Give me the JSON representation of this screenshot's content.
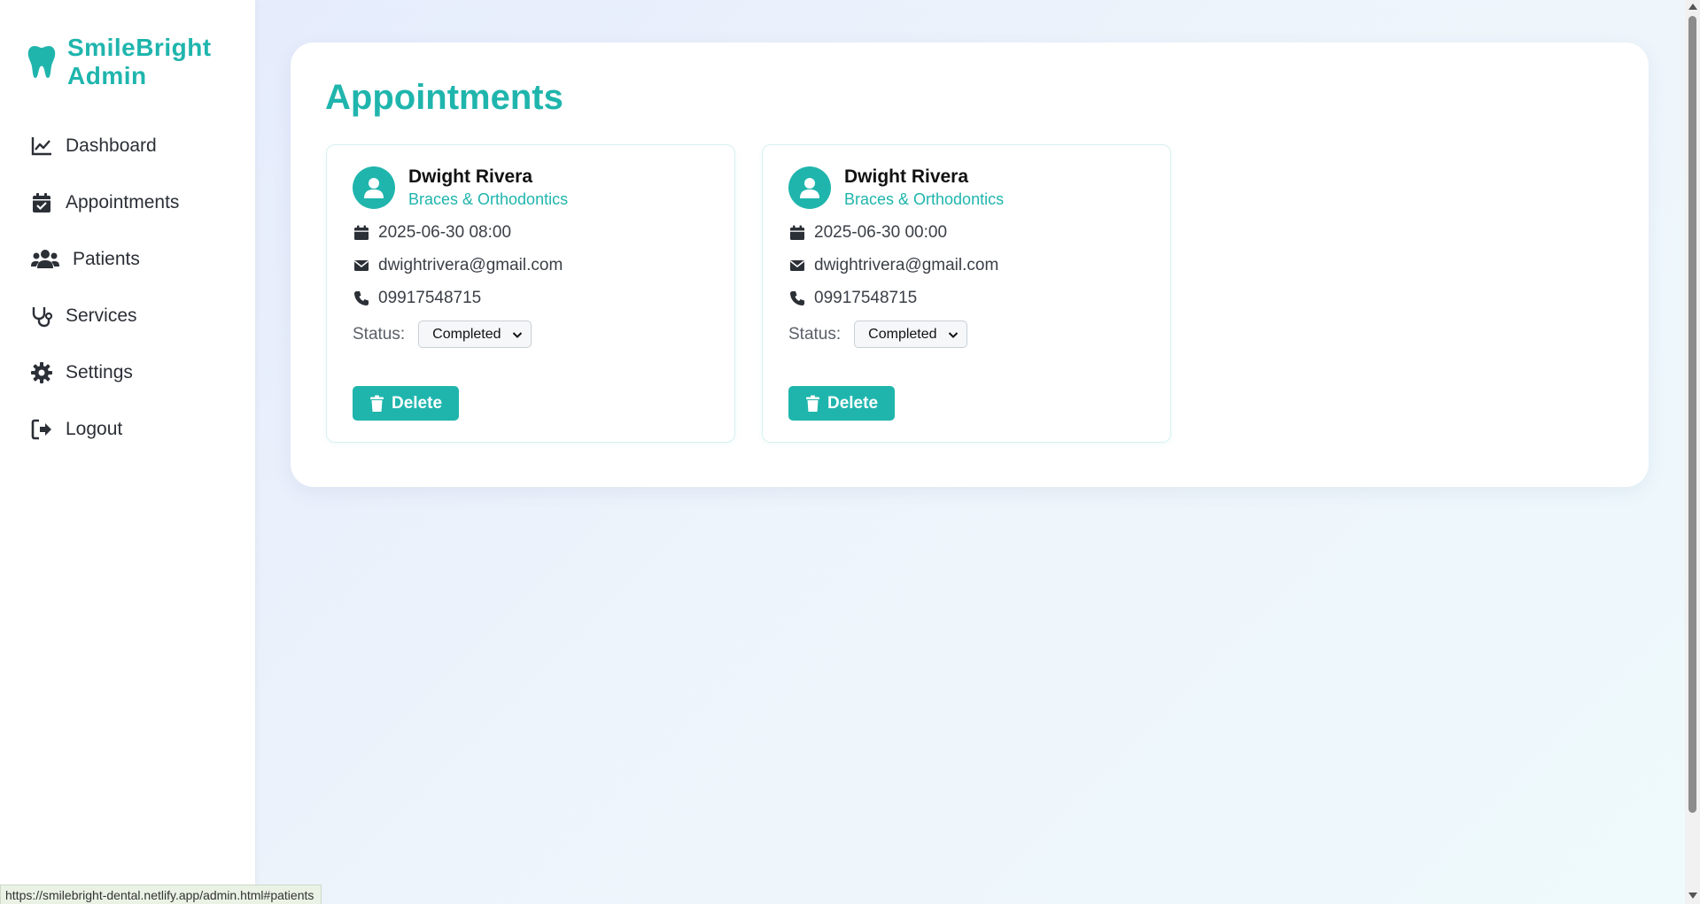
{
  "brand": {
    "name": "SmileBright Admin",
    "icon": "tooth-icon",
    "accent": "#1fb5ad"
  },
  "sidebar": {
    "items": [
      {
        "label": "Dashboard",
        "icon": "chart-line-icon"
      },
      {
        "label": "Appointments",
        "icon": "calendar-check-icon"
      },
      {
        "label": "Patients",
        "icon": "users-icon"
      },
      {
        "label": "Services",
        "icon": "stethoscope-icon"
      },
      {
        "label": "Settings",
        "icon": "gear-icon"
      },
      {
        "label": "Logout",
        "icon": "logout-icon"
      }
    ]
  },
  "main": {
    "title": "Appointments",
    "appointments": [
      {
        "name": "Dwight Rivera",
        "service": "Braces & Orthodontics",
        "datetime": "2025-06-30 08:00",
        "email": "dwightrivera@gmail.com",
        "phone": "09917548715",
        "status_label": "Status:",
        "status": "Completed",
        "delete_label": "Delete"
      },
      {
        "name": "Dwight Rivera",
        "service": "Braces & Orthodontics",
        "datetime": "2025-06-30 00:00",
        "email": "dwightrivera@gmail.com",
        "phone": "09917548715",
        "status_label": "Status:",
        "status": "Completed",
        "delete_label": "Delete"
      }
    ]
  },
  "browser": {
    "status_url": "https://smilebright-dental.netlify.app/admin.html#patients"
  }
}
